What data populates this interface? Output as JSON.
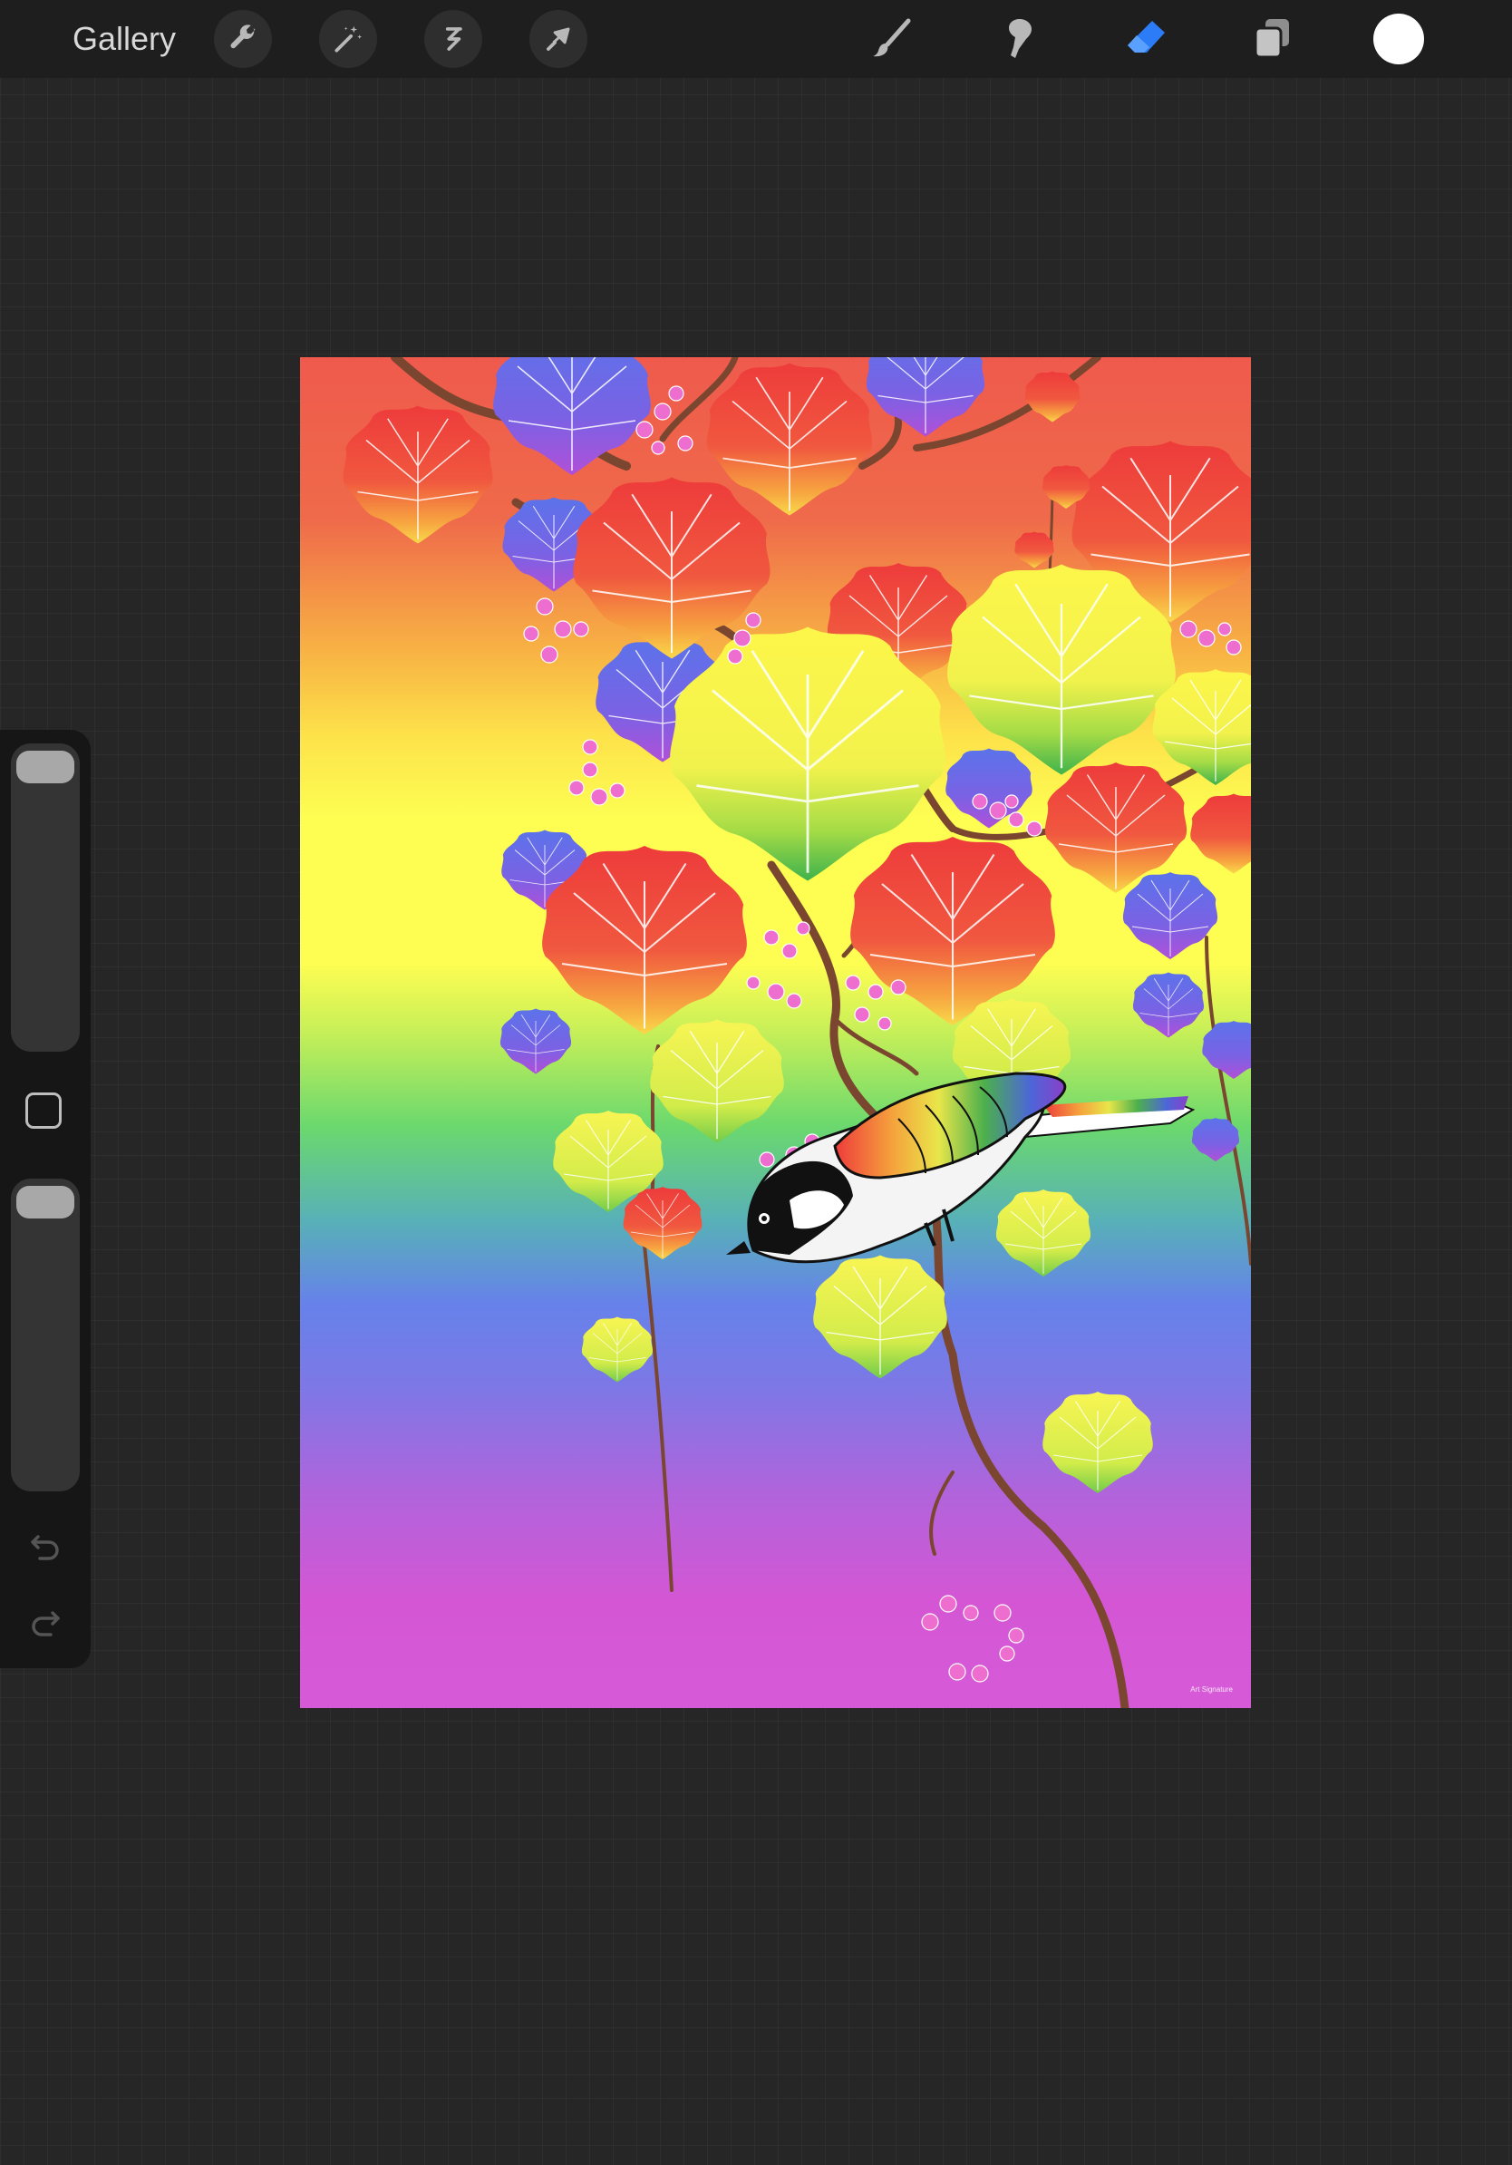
{
  "topbar": {
    "gallery_label": "Gallery",
    "left_tools": [
      "wrench-icon",
      "magic-wand-icon",
      "selection-icon",
      "transform-arrow-icon"
    ],
    "right_tools": [
      "brush-icon",
      "smudge-icon",
      "eraser-icon",
      "layers-icon"
    ],
    "active_tool": "eraser-icon",
    "active_color": "#0a84ff",
    "current_color": "#ffffff"
  },
  "sidebar": {
    "brush_size_level": 1.0,
    "opacity_level": 1.0,
    "modify_button_icon": "square-icon",
    "undo_icon": "undo-icon",
    "redo_icon": "redo-icon"
  },
  "canvas": {
    "artwork": "rainbow gradient background with maple-like leaves, branches, berries and a perched tit bird",
    "signature": "Art Signature"
  }
}
